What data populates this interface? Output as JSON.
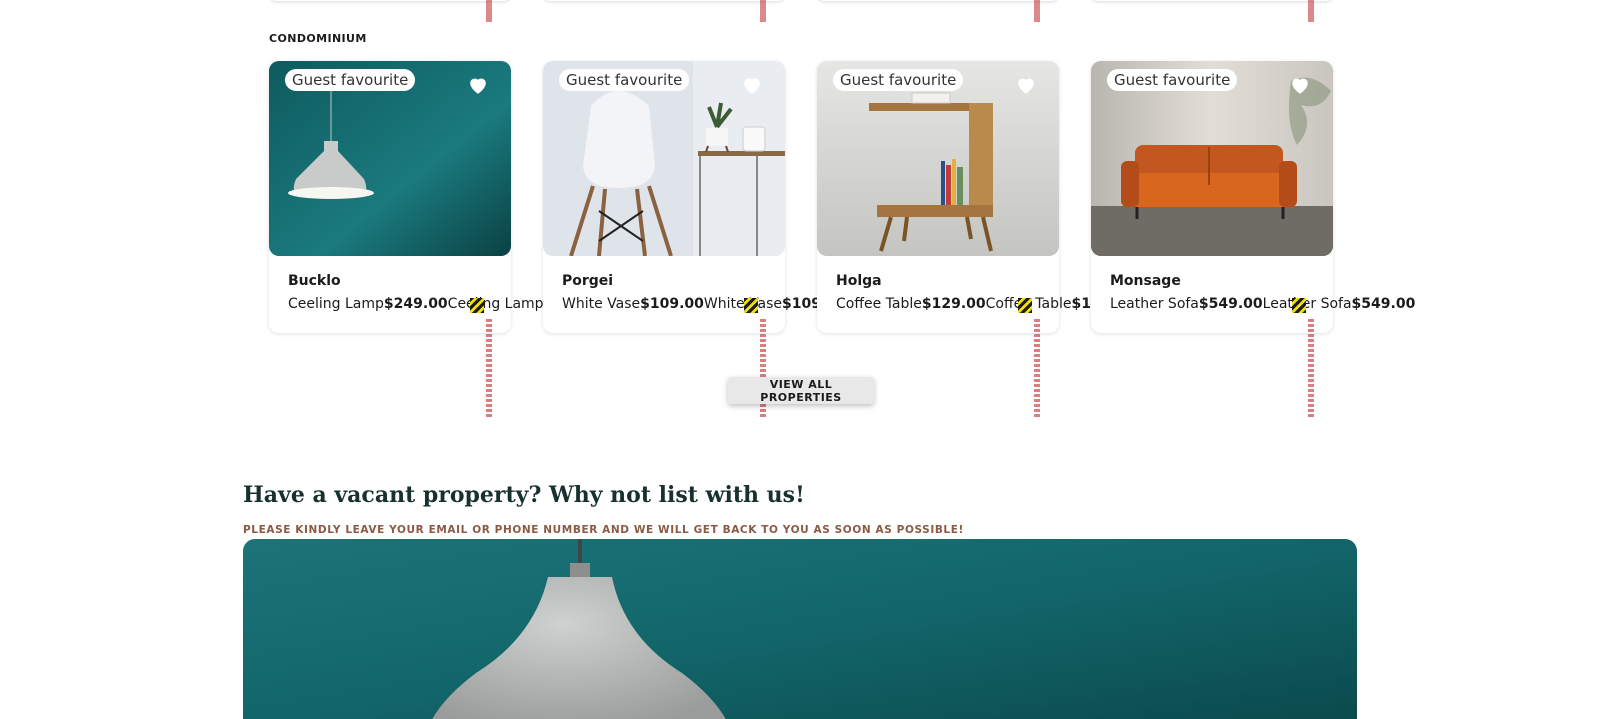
{
  "section": {
    "label": "CONDOMINIUM"
  },
  "cards": [
    {
      "badge": "Guest favourite",
      "title": "Bucklo",
      "item": "Ceeling Lamp",
      "price": "$249.00",
      "repeat_item": "Ceeling Lamp",
      "photo": "pendant-lamp"
    },
    {
      "badge": "Guest favourite",
      "title": "Porgei",
      "item": "White Vase",
      "price": "$109.00",
      "repeat_item": "White Vase",
      "repeat_price": "$109.",
      "photo": "white-chair"
    },
    {
      "badge": "Guest favourite",
      "title": "Holga",
      "item": "Coffee Table",
      "price": "$129.00",
      "repeat_item": "Coffee Table",
      "repeat_price": "$1",
      "photo": "side-table"
    },
    {
      "badge": "Guest favourite",
      "title": "Monsage",
      "item": "Leather Sofa",
      "price": "$549.00",
      "repeat_item": "Leather Sofa",
      "repeat_price": "$549.00",
      "photo": "orange-sofa"
    }
  ],
  "view_all": {
    "label": "VIEW ALL PROPERTIES"
  },
  "cta": {
    "title": "Have a vacant property? Why not list with us!",
    "subtitle": "PLEASE KINDLY LEAVE YOUR EMAIL OR PHONE NUMBER AND WE WILL GET BACK TO YOU AS SOON AS POSSIBLE!"
  },
  "colors": {
    "teal": "#0f5a5c",
    "heading": "#18302e",
    "subtitle": "#8b5a44",
    "overflow_marker": "#c0282d"
  }
}
